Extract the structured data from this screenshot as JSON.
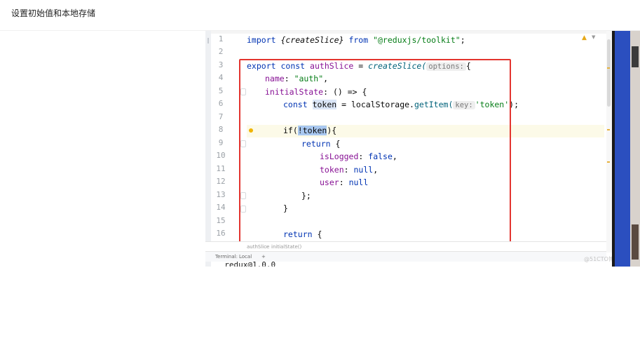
{
  "page": {
    "heading": "设置初始值和本地存储"
  },
  "editor": {
    "line_numbers": [
      "1",
      "2",
      "3",
      "4",
      "5",
      "6",
      "7",
      "8",
      "9",
      "10",
      "11",
      "12",
      "13",
      "14",
      "15",
      "16"
    ],
    "code": {
      "l1_import": "import",
      "l1_name": "{createSlice}",
      "l1_from": "from",
      "l1_path": "\"@reduxjs/toolkit\"",
      "l1_semi": ";",
      "l3_export": "export",
      "l3_const": "const",
      "l3_auth": "authSlice",
      "l3_eq": "=",
      "l3_fn": "createSlice(",
      "l3_hint": "options:",
      "l3_brace": "{",
      "l4_key": "name",
      "l4_colon": ":",
      "l4_value": "\"auth\"",
      "l4_comma": ",",
      "l5_key": "initialState",
      "l5_rest": ": () => {",
      "l6_const": "const",
      "l6_var": "token",
      "l6_eq": "= localStorage.",
      "l6_method": "getItem(",
      "l6_hint": "key:",
      "l6_arg": "'token'",
      "l6_end": ");",
      "l8_if": "if(",
      "l8_bang": "!",
      "l8_token": "token",
      "l8_end": "){",
      "l9_return": "return",
      "l9_brace": "{",
      "l10_key": "isLogged",
      "l10_colon": ":",
      "l10_value": "false",
      "l10_comma": ",",
      "l11_key": "token",
      "l11_colon": ":",
      "l11_value": "null",
      "l11_comma": ",",
      "l12_key": "user",
      "l12_colon": ":",
      "l12_value": "null",
      "l13_close": "};",
      "l14_close": "}",
      "l16_return": "return",
      "l16_brace": "{"
    },
    "breadcrumb": [
      "authSlice",
      "initialState()"
    ],
    "breadcrumb_sep": "›",
    "terminal_tab": "Terminal:",
    "terminal_local": "Local",
    "terminal_add": "+",
    "terminal_line": "  redux@1.0.0",
    "watermark": "@51CTO博客"
  },
  "colors": {
    "highlight_box": "#e3342f",
    "keyword": "#0033b3",
    "string": "#067d17",
    "property": "#871094",
    "current_line": "#fcfae8"
  }
}
